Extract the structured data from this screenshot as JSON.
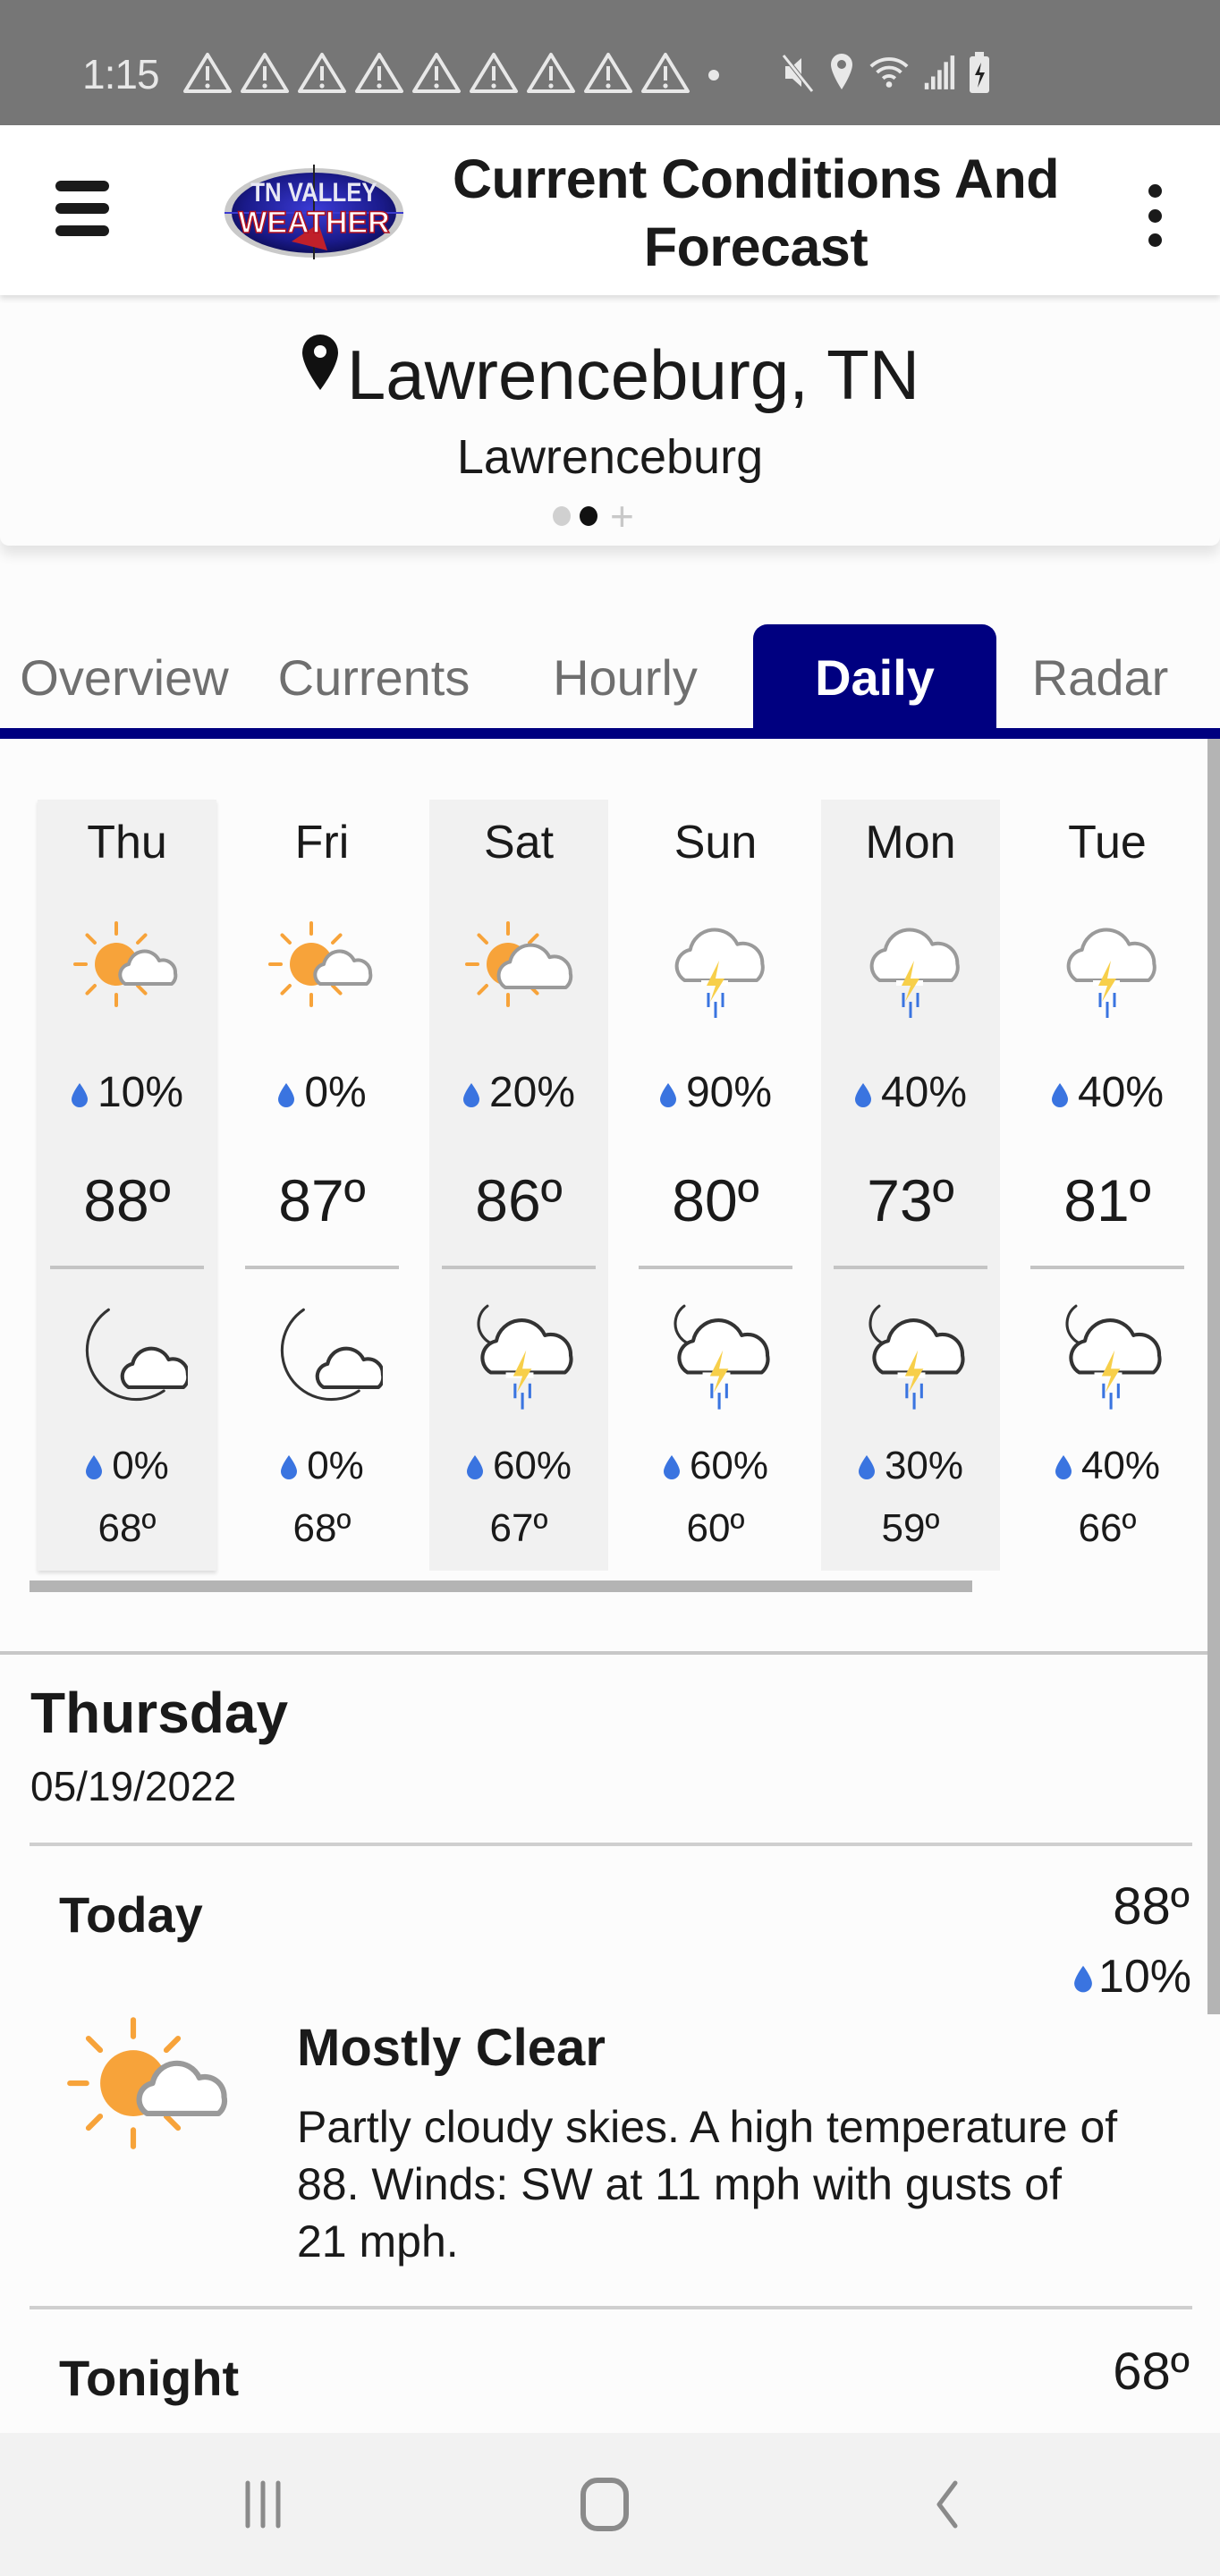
{
  "status_bar": {
    "time": "1:15",
    "warning_icon_count": 9,
    "icons": [
      "mute-icon",
      "location-icon",
      "wifi-icon",
      "signal-icon",
      "battery-charging-icon"
    ]
  },
  "header": {
    "title": "Current Conditions And Forecast",
    "logo_text_top": "TN VALLEY",
    "logo_text_bottom": "WEATHER"
  },
  "location": {
    "title": "Lawrenceburg, TN",
    "subtitle": "Lawrenceburg",
    "pager": {
      "pages": 2,
      "active_index": 1,
      "add_label": "+"
    }
  },
  "tabs": [
    {
      "label": "Overview",
      "active": false
    },
    {
      "label": "Currents",
      "active": false
    },
    {
      "label": "Hourly",
      "active": false
    },
    {
      "label": "Daily",
      "active": true
    },
    {
      "label": "Radar",
      "active": false
    }
  ],
  "colors": {
    "accent": "#000080",
    "precip_drop": "#3a74e0",
    "sun": "#f7a33a",
    "moon": "#f9d46a",
    "bolt": "#f7cf4a",
    "cloud_stroke": "#9a9a9a"
  },
  "daily": [
    {
      "day": "Thu",
      "day_icon": "partly-cloudy-day-icon",
      "day_precip": "10%",
      "high": "88º",
      "night_icon": "partly-cloudy-night-icon",
      "night_precip": "0%",
      "low": "68º",
      "shaded": true
    },
    {
      "day": "Fri",
      "day_icon": "partly-cloudy-day-icon",
      "day_precip": "0%",
      "high": "87º",
      "night_icon": "partly-cloudy-night-icon",
      "night_precip": "0%",
      "low": "68º",
      "shaded": false
    },
    {
      "day": "Sat",
      "day_icon": "mostly-cloudy-day-icon",
      "day_precip": "20%",
      "high": "86º",
      "night_icon": "night-thunderstorm-icon",
      "night_precip": "60%",
      "low": "67º",
      "shaded": true
    },
    {
      "day": "Sun",
      "day_icon": "thunderstorm-icon",
      "day_precip": "90%",
      "high": "80º",
      "night_icon": "night-thunderstorm-icon",
      "night_precip": "60%",
      "low": "60º",
      "shaded": false
    },
    {
      "day": "Mon",
      "day_icon": "thunderstorm-icon",
      "day_precip": "40%",
      "high": "73º",
      "night_icon": "night-thunderstorm-icon",
      "night_precip": "30%",
      "low": "59º",
      "shaded": true
    },
    {
      "day": "Tue",
      "day_icon": "thunderstorm-icon",
      "day_precip": "40%",
      "high": "81º",
      "night_icon": "night-thunderstorm-icon",
      "night_precip": "40%",
      "low": "66º",
      "shaded": false
    }
  ],
  "detail": {
    "day_name": "Thursday",
    "date": "05/19/2022",
    "periods": [
      {
        "label": "Today",
        "temp": "88º",
        "precip": "10%",
        "icon": "partly-cloudy-day-icon",
        "condition": "Mostly Clear",
        "description": "Partly cloudy skies.  A high temperature of 88.  Winds: SW at 11 mph with gusts of 21 mph."
      },
      {
        "label": "Tonight",
        "temp": "68º"
      }
    ]
  },
  "nav_bar": {
    "buttons": [
      "recent-apps",
      "home",
      "back"
    ]
  }
}
